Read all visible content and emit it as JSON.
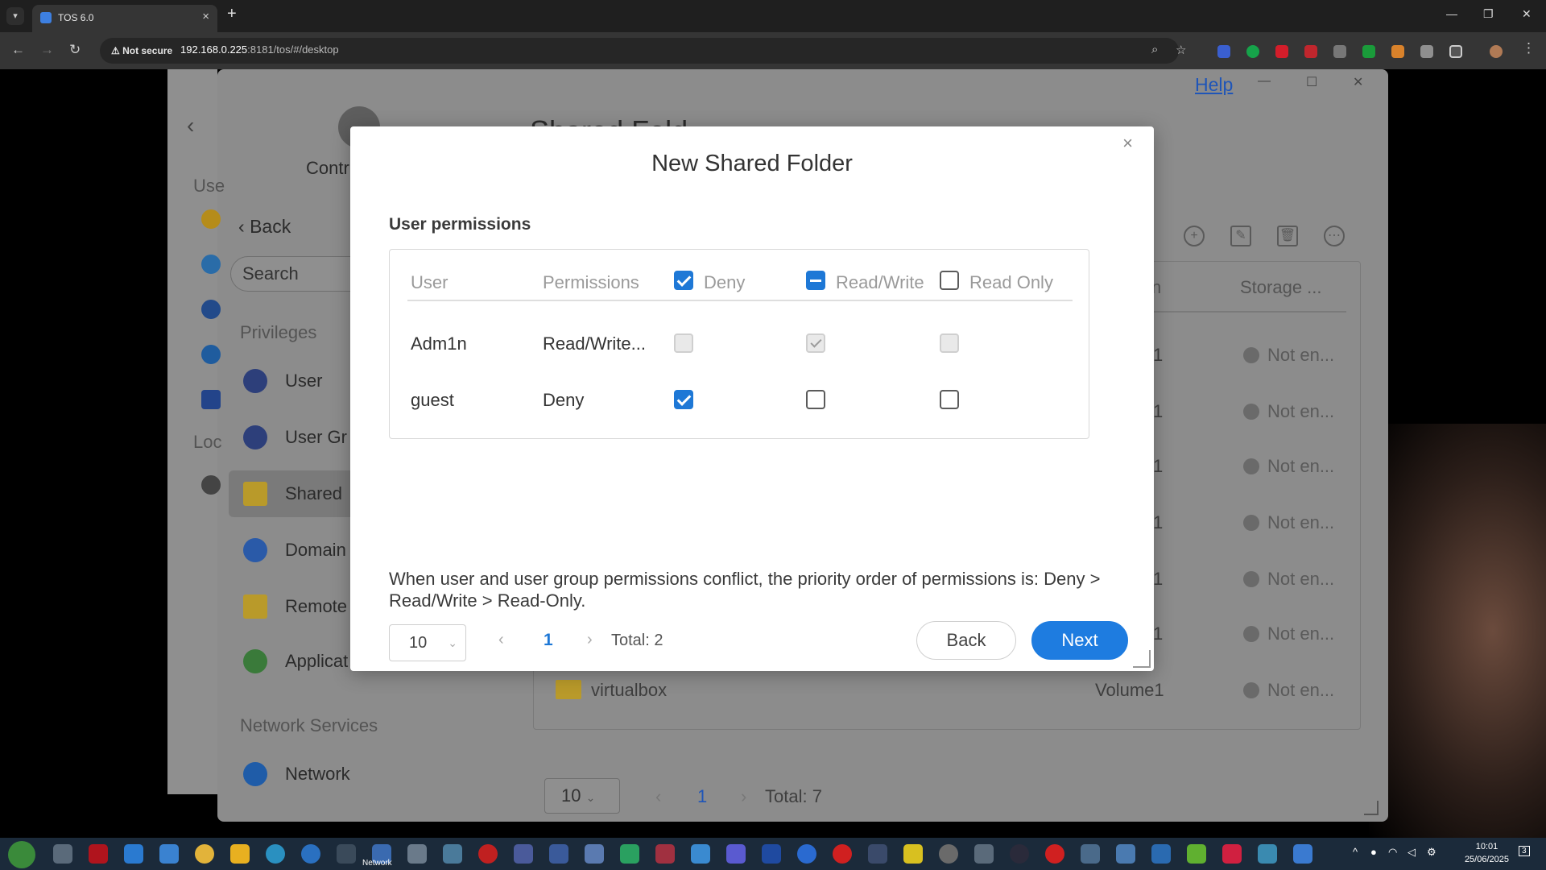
{
  "browser": {
    "tab_title": "TOS 6.0",
    "security_label": "Not secure",
    "url_host": "192.168.0.225",
    "url_rest": ":8181/tos/#/desktop",
    "icons": [
      "back-icon",
      "forward-icon",
      "reload-icon",
      "zoom-icon",
      "star-icon",
      "extensions-icon",
      "profile-icon",
      "menu-icon"
    ]
  },
  "control_panel": {
    "help_label": "Help",
    "partial_title": "Contr",
    "heading": "Shared Fold",
    "back_label": "Back",
    "search_placeholder": "Search",
    "left_strip": {
      "user_partial": "Use",
      "local_partial": "Loc"
    },
    "sections": {
      "privileges": "Privileges",
      "network_services": "Network Services"
    },
    "sidebar_items": [
      {
        "label": "User",
        "icon": "user-icon"
      },
      {
        "label": "User Gr",
        "icon": "user-group-icon"
      },
      {
        "label": "Shared",
        "icon": "folder-icon"
      },
      {
        "label": "Domain",
        "icon": "domain-icon"
      },
      {
        "label": "Remote",
        "icon": "remote-folder-icon"
      },
      {
        "label": "Applicat",
        "icon": "application-icon"
      },
      {
        "label": "Network",
        "icon": "globe-icon"
      }
    ],
    "table_headers": {
      "location_partial": "n",
      "storage": "Storage ..."
    },
    "rows": [
      {
        "location": "1",
        "status": "Not en..."
      },
      {
        "location": "1",
        "status": "Not en..."
      },
      {
        "location": "1",
        "status": "Not en..."
      },
      {
        "location": "1",
        "status": "Not en..."
      },
      {
        "location": "1",
        "status": "Not en..."
      },
      {
        "location": "1",
        "status": "Not en..."
      },
      {
        "name": "virtualbox",
        "location": "Volume1",
        "status": "Not en..."
      }
    ],
    "pager": {
      "page_size": "10",
      "page": "1",
      "total": "Total: 7"
    }
  },
  "modal": {
    "title": "New Shared Folder",
    "section_title": "User permissions",
    "headers": {
      "user": "User",
      "permissions": "Permissions",
      "deny": "Deny",
      "read_write": "Read/Write",
      "read_only": "Read Only"
    },
    "rows": [
      {
        "user": "Adm1n",
        "permission": "Read/Write...",
        "deny": "disabled",
        "read_write": "disabled-checked",
        "read_only": "disabled"
      },
      {
        "user": "guest",
        "permission": "Deny",
        "deny": "checked",
        "read_write": "unchecked",
        "read_only": "unchecked"
      }
    ],
    "note": "When user and user group permissions conflict, the priority order of permissions is: Deny > Read/Write > Read-Only.",
    "pager": {
      "page_size": "10",
      "page": "1",
      "total": "Total: 2"
    },
    "back_label": "Back",
    "next_label": "Next"
  },
  "taskbar": {
    "time": "10:01",
    "date": "25/06/2025",
    "notification_count": "3",
    "network_label": "Network"
  },
  "colors": {
    "accent": "#1e7ce0",
    "dim": "#8c8c8c"
  }
}
